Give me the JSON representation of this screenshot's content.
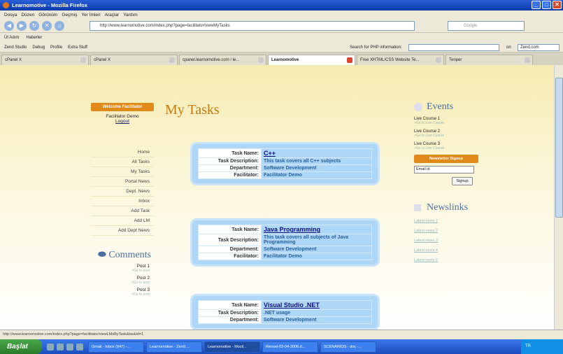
{
  "window": {
    "title": "Learnomotive - Mozilla Firefox"
  },
  "menu": [
    "Dosya",
    "Düzen",
    "Görünüm",
    "Geçmiş",
    "Yer İmleri",
    "Araçlar",
    "Yardım"
  ],
  "nav": {
    "url": "http://www.learnomotive.com/index.php?page=facilitator/viewMyTasks",
    "search_placeholder": "Google"
  },
  "bookmarks": [
    "Üt Adım",
    "Haberler"
  ],
  "toolbar2": {
    "items": [
      "Zend Studio",
      "Debug",
      "Profile",
      "Extra Stuff"
    ],
    "php_label": "Search for PHP information:",
    "on_label": "on",
    "site": "Zend.com"
  },
  "tabs": [
    {
      "label": "cPanel X"
    },
    {
      "label": "cPanel X"
    },
    {
      "label": "cpanel.learnomotive.com / le..."
    },
    {
      "label": "Learnomotive"
    },
    {
      "label": "Free XHTML/CSS Website Te..."
    },
    {
      "label": "Tenper"
    }
  ],
  "page": {
    "title": "My Tasks",
    "welcome": "Welcome Facilitator",
    "user": "Facilitator Demo",
    "logout": "Logout",
    "nav": [
      "Home",
      "All Tasks",
      "My Tasks",
      "Portal News",
      "Dept. News",
      "Inbox",
      "Add Task",
      "Add LM",
      "Add Dept News"
    ],
    "comments_title": "Comments",
    "posts": [
      {
        "title": "Post 1",
        "link": ">Go to post"
      },
      {
        "title": "Post 2",
        "link": ">Go to post"
      },
      {
        "title": "Post 3",
        "link": ">Go to post"
      }
    ],
    "labels": {
      "name": "Task Name:",
      "desc": "Task Description:",
      "dept": "Department:",
      "fac": "Facilitator:"
    },
    "tasks": [
      {
        "name": "C++",
        "desc": "This task covers all C++ subjects",
        "dept": "Software Development",
        "fac": "Facilitator Demo"
      },
      {
        "name": "Java Programming",
        "desc": "This task covers all subjects of Java Programming",
        "dept": "Software Development",
        "fac": "Facilitator Demo"
      },
      {
        "name": "Visual Studio .NET",
        "desc": ".NET usage",
        "dept": "Software Development",
        "fac": ""
      }
    ],
    "events_title": "Events",
    "events": [
      {
        "title": "Live Course 1",
        "link": ">Go to Live Course"
      },
      {
        "title": "Live Course 2",
        "link": ">Go to Live Course"
      },
      {
        "title": "Live Course 3",
        "link": ">Go to Live Course"
      }
    ],
    "newsletter": "Newsletter Signup",
    "email_value": "Email id",
    "signup": "Signup",
    "newslinks_title": "Newslinks",
    "news": [
      "Latest news 1",
      "Latest news 2",
      "Latest news 3",
      "Latest news 4",
      "Latest news 5"
    ]
  },
  "status": "http://www.learnomotive.com/index.php?page=facilitator/viewLMsByTask&taskid=1",
  "taskbar": {
    "start": "Başlat",
    "items": [
      "Gmail - Inbox (947) -...",
      "Learnomotive - Zend ...",
      "Learnomotive - Mozil...",
      "Rensel-03-04-2006.d...",
      "SCENARIOS - doc -..."
    ],
    "tray": "TR"
  }
}
